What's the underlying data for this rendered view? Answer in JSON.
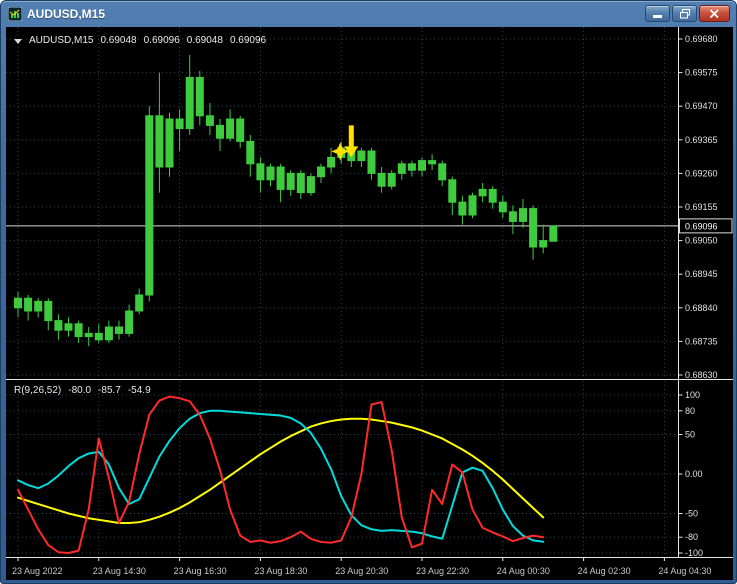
{
  "window": {
    "title": "AUDUSD,M15",
    "controls": {
      "minimize_icon": "minimize-bar",
      "restore_icon": "overlapping-windows",
      "close_icon": "x-cross"
    }
  },
  "chart_header": {
    "symbol": "AUDUSD,M15",
    "dropdown_icon": "down-triangle",
    "open": "0.69048",
    "high": "0.69096",
    "low": "0.69048",
    "close": "0.69096"
  },
  "indicator_header": {
    "label": "R(9,26,52)",
    "value1": "-80.0",
    "value2": "-85.7",
    "value3": "-54.9"
  },
  "colors": {
    "background": "#000000",
    "foreground": "#e8e8e8",
    "grid": "#334050",
    "candle": "#3ecc3e",
    "body_fill": "#3ecc3e",
    "bid_line": "#dcdcdc",
    "axis_text": "#e0e0e0",
    "time_text": "#c8c8c8",
    "marker": "#ffe100",
    "r9": "#ff2a2a",
    "r26": "#00dcdc",
    "r52": "#ffff00"
  },
  "chart_data": {
    "type": "candlestick",
    "symbol": "AUDUSD",
    "timeframe": "M15",
    "title": "AUDUSD,M15",
    "bid": {
      "value": 0.69096,
      "label": "0.69096"
    },
    "price_axis": {
      "labels": [
        "0.69680",
        "0.69575",
        "0.69470",
        "0.69365",
        "0.69260",
        "0.69155",
        "0.69050",
        "0.68945",
        "0.68840",
        "0.68735",
        "0.68630"
      ],
      "values": [
        0.6968,
        0.69575,
        0.6947,
        0.69365,
        0.6926,
        0.69155,
        0.6905,
        0.68945,
        0.6884,
        0.68735,
        0.6863
      ]
    },
    "time_axis": {
      "labels": [
        {
          "text": "23 Aug 2022",
          "index": 0
        },
        {
          "text": "23 Aug 14:30",
          "index": 8
        },
        {
          "text": "23 Aug 16:30",
          "index": 16
        },
        {
          "text": "23 Aug 18:30",
          "index": 24
        },
        {
          "text": "23 Aug 20:30",
          "index": 32
        },
        {
          "text": "23 Aug 22:30",
          "index": 40
        },
        {
          "text": "24 Aug 00:30",
          "index": 48
        },
        {
          "text": "24 Aug 02:30",
          "index": 56
        },
        {
          "text": "24 Aug 04:30",
          "index": 64
        }
      ]
    },
    "candles": [
      [
        0.6884,
        0.6889,
        0.6881,
        0.6887
      ],
      [
        0.6887,
        0.6888,
        0.688,
        0.6883
      ],
      [
        0.6883,
        0.6887,
        0.6881,
        0.6886
      ],
      [
        0.6886,
        0.6887,
        0.6877,
        0.688
      ],
      [
        0.688,
        0.6882,
        0.6874,
        0.6877
      ],
      [
        0.6877,
        0.6881,
        0.6875,
        0.6879
      ],
      [
        0.6879,
        0.688,
        0.6873,
        0.6875
      ],
      [
        0.6875,
        0.6878,
        0.6872,
        0.6876
      ],
      [
        0.6876,
        0.6879,
        0.6873,
        0.6874
      ],
      [
        0.6874,
        0.688,
        0.6873,
        0.6878
      ],
      [
        0.6878,
        0.688,
        0.6874,
        0.6876
      ],
      [
        0.6876,
        0.6885,
        0.6875,
        0.6883
      ],
      [
        0.6883,
        0.689,
        0.6882,
        0.6888
      ],
      [
        0.6888,
        0.6947,
        0.6886,
        0.6944
      ],
      [
        0.6944,
        0.69575,
        0.692,
        0.6928
      ],
      [
        0.6928,
        0.6945,
        0.6925,
        0.6943
      ],
      [
        0.6943,
        0.6946,
        0.6933,
        0.694
      ],
      [
        0.694,
        0.6963,
        0.6938,
        0.6956
      ],
      [
        0.6956,
        0.6958,
        0.6941,
        0.6944
      ],
      [
        0.6944,
        0.6948,
        0.6938,
        0.6941
      ],
      [
        0.6941,
        0.6943,
        0.6933,
        0.6937
      ],
      [
        0.6937,
        0.6946,
        0.6936,
        0.6943
      ],
      [
        0.6943,
        0.6944,
        0.6934,
        0.6936
      ],
      [
        0.6936,
        0.6938,
        0.6925,
        0.6929
      ],
      [
        0.6929,
        0.6931,
        0.692,
        0.6924
      ],
      [
        0.6924,
        0.6929,
        0.6922,
        0.6928
      ],
      [
        0.6928,
        0.6929,
        0.6917,
        0.6921
      ],
      [
        0.6921,
        0.6927,
        0.6919,
        0.6926
      ],
      [
        0.6926,
        0.6927,
        0.6918,
        0.692
      ],
      [
        0.692,
        0.6926,
        0.6919,
        0.6925
      ],
      [
        0.6925,
        0.6929,
        0.6923,
        0.6928
      ],
      [
        0.6928,
        0.6934,
        0.6926,
        0.6931
      ],
      [
        0.6931,
        0.6936,
        0.6929,
        0.6934
      ],
      [
        0.6934,
        0.6936,
        0.6928,
        0.693
      ],
      [
        0.693,
        0.6934,
        0.6928,
        0.6933
      ],
      [
        0.6933,
        0.6934,
        0.6924,
        0.6926
      ],
      [
        0.6926,
        0.6928,
        0.692,
        0.6922
      ],
      [
        0.6922,
        0.6927,
        0.6921,
        0.6926
      ],
      [
        0.6926,
        0.693,
        0.6924,
        0.6929
      ],
      [
        0.6929,
        0.693,
        0.6925,
        0.6927
      ],
      [
        0.6927,
        0.6931,
        0.6925,
        0.693
      ],
      [
        0.693,
        0.6932,
        0.6927,
        0.6929
      ],
      [
        0.6929,
        0.693,
        0.6922,
        0.6924
      ],
      [
        0.6924,
        0.6925,
        0.6913,
        0.6917
      ],
      [
        0.6917,
        0.6919,
        0.691,
        0.6913
      ],
      [
        0.6913,
        0.692,
        0.6912,
        0.6919
      ],
      [
        0.6919,
        0.6923,
        0.6917,
        0.6921
      ],
      [
        0.6921,
        0.6922,
        0.6915,
        0.6917
      ],
      [
        0.6917,
        0.6919,
        0.6912,
        0.6914
      ],
      [
        0.6914,
        0.6916,
        0.6907,
        0.6911
      ],
      [
        0.6911,
        0.6918,
        0.6909,
        0.6915
      ],
      [
        0.6915,
        0.6916,
        0.6899,
        0.6903
      ],
      [
        0.6903,
        0.691,
        0.6901,
        0.6905
      ],
      [
        0.69048,
        0.69096,
        0.69048,
        0.69096
      ]
    ],
    "marker": {
      "shape": "yellow-down-arrow-with-star",
      "bar_index": 33,
      "price": 0.6931
    },
    "indicator_panel": {
      "name": "R(9,26,52)",
      "type": "line",
      "range": [
        -100,
        100
      ],
      "axis_labels": [
        "100",
        "80",
        "50",
        "0.00",
        "-50",
        "-80",
        "-100"
      ],
      "axis_values": [
        100,
        80,
        50,
        0,
        -50,
        -80,
        -100
      ],
      "current_values": [
        -80.0,
        -85.7,
        -54.9
      ],
      "series": [
        {
          "name": "R9",
          "color_key": "r9",
          "values": [
            -20,
            -45,
            -70,
            -90,
            -99,
            -100,
            -97,
            -45,
            45,
            -5,
            -62,
            -35,
            25,
            75,
            93,
            98,
            96,
            92,
            75,
            45,
            5,
            -45,
            -78,
            -86,
            -84,
            -87,
            -85,
            -80,
            -73,
            -82,
            -86,
            -87,
            -84,
            -55,
            0,
            88,
            91,
            30,
            -55,
            -93,
            -88,
            -20,
            -38,
            12,
            2,
            -45,
            -68,
            -74,
            -79,
            -85,
            -81,
            -78,
            -80
          ]
        },
        {
          "name": "R26",
          "color_key": "r26",
          "values": [
            -8,
            -14,
            -18,
            -12,
            -2,
            10,
            20,
            26,
            28,
            12,
            -18,
            -38,
            -32,
            -5,
            22,
            42,
            58,
            70,
            77,
            80,
            80,
            79,
            78,
            77,
            76,
            75,
            74,
            71,
            64,
            52,
            32,
            6,
            -28,
            -52,
            -65,
            -70,
            -72,
            -71,
            -72,
            -73,
            -75,
            -79,
            -82,
            -40,
            2,
            8,
            4,
            -18,
            -45,
            -66,
            -78,
            -84,
            -85.7
          ]
        },
        {
          "name": "R52",
          "color_key": "r52",
          "values": [
            -30,
            -34,
            -38,
            -42,
            -46,
            -50,
            -53,
            -56,
            -58,
            -60,
            -62,
            -62,
            -61,
            -58,
            -54,
            -49,
            -43,
            -36,
            -28,
            -20,
            -11,
            -2,
            7,
            16,
            25,
            33,
            41,
            48,
            54,
            60,
            64,
            67,
            69,
            70,
            70,
            69,
            67,
            65,
            62,
            59,
            55,
            50,
            45,
            38,
            31,
            23,
            14,
            4,
            -7,
            -19,
            -31,
            -43,
            -54.9
          ]
        }
      ]
    }
  }
}
